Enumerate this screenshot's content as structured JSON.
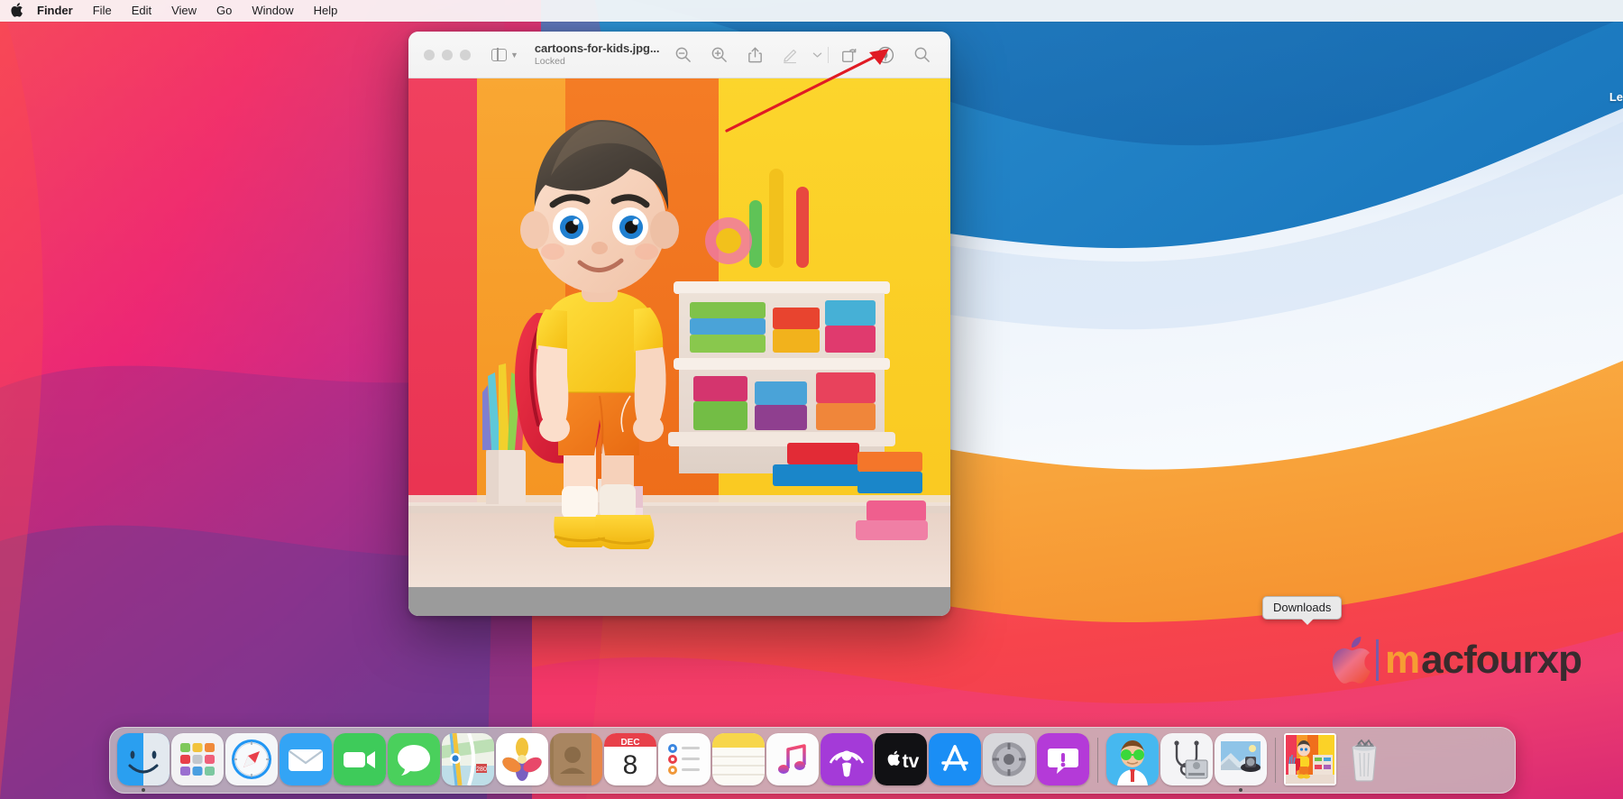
{
  "menubar": {
    "apple_icon": "apple-logo",
    "items": [
      {
        "label": "Finder",
        "bold": true
      },
      {
        "label": "File",
        "bold": false
      },
      {
        "label": "Edit",
        "bold": false
      },
      {
        "label": "View",
        "bold": false
      },
      {
        "label": "Go",
        "bold": false
      },
      {
        "label": "Window",
        "bold": false
      },
      {
        "label": "Help",
        "bold": false
      }
    ]
  },
  "preview_window": {
    "app": "Preview",
    "title": "cartoons-for-kids.jpg...",
    "subtitle": "Locked",
    "traffic_lights": [
      "close",
      "minimize",
      "zoom"
    ],
    "sidebar_toggle": "sidebar-icon",
    "toolbar": [
      {
        "name": "zoom-out-button",
        "icon": "magnifier-minus-icon"
      },
      {
        "name": "zoom-in-button",
        "icon": "magnifier-plus-icon"
      },
      {
        "name": "share-button",
        "icon": "share-icon"
      },
      {
        "name": "markup-pen-button",
        "icon": "pen-icon"
      },
      {
        "name": "markup-dropdown-button",
        "icon": "chevron-down-icon"
      },
      {
        "name": "rotate-button",
        "icon": "rotate-icon"
      },
      {
        "name": "markup-toolbar-button",
        "icon": "markup-circle-pen-icon"
      },
      {
        "name": "search-button",
        "icon": "search-icon"
      }
    ]
  },
  "annotation": {
    "type": "arrow",
    "color": "#e01b24",
    "points_to": "markup-toolbar-button"
  },
  "desktop": {
    "right_edge_text": "Le",
    "wallpaper": "macOS Big Sur waves",
    "colors": {
      "pink": "#f2357a",
      "red": "#f9464b",
      "orange": "#f6a23b",
      "blue": "#1f7ec2",
      "purple": "#6b3f8e"
    }
  },
  "watermark": {
    "apple_icon": "apple-logo",
    "text_m": "m",
    "text_rest": "acfourxp"
  },
  "tooltip": {
    "label": "Downloads"
  },
  "dock": {
    "items": [
      {
        "name": "finder",
        "label": "Finder",
        "running": true
      },
      {
        "name": "launchpad",
        "label": "Launchpad",
        "running": false
      },
      {
        "name": "safari",
        "label": "Safari",
        "running": false
      },
      {
        "name": "mail",
        "label": "Mail",
        "running": false
      },
      {
        "name": "facetime",
        "label": "FaceTime",
        "running": false
      },
      {
        "name": "messages",
        "label": "Messages",
        "running": false
      },
      {
        "name": "maps",
        "label": "Maps",
        "running": false
      },
      {
        "name": "photos",
        "label": "Photos",
        "running": false
      },
      {
        "name": "contacts",
        "label": "Contacts",
        "running": false
      },
      {
        "name": "calendar",
        "label": "Calendar",
        "running": false,
        "month": "DEC",
        "day": "8"
      },
      {
        "name": "reminders",
        "label": "Reminders",
        "running": false
      },
      {
        "name": "notes",
        "label": "Notes",
        "running": false
      },
      {
        "name": "music",
        "label": "Music",
        "running": false
      },
      {
        "name": "podcasts",
        "label": "Podcasts",
        "running": false
      },
      {
        "name": "appletv",
        "label": "Apple TV",
        "running": false
      },
      {
        "name": "appstore",
        "label": "App Store",
        "running": false
      },
      {
        "name": "system-preferences",
        "label": "System Preferences",
        "running": false
      },
      {
        "name": "alert-app",
        "label": "Alert",
        "running": false
      }
    ],
    "stack_items": [
      {
        "name": "mac-doctor",
        "label": "Mac Doctor"
      },
      {
        "name": "disk-utility",
        "label": "Disk Utility"
      },
      {
        "name": "preview",
        "label": "Preview",
        "running": true
      },
      {
        "name": "downloads-stack",
        "label": "Downloads"
      },
      {
        "name": "trash",
        "label": "Trash"
      }
    ]
  },
  "document_image": {
    "description": "3D cartoon boy with backpack in a toy room",
    "panel_colors": [
      "#ee3a5b",
      "#f6912b",
      "#f2701f",
      "#fbd422"
    ],
    "subject": {
      "shirt": "#fbd424",
      "shorts": "#f07a1e",
      "backpack": "#e02233",
      "shoes": "#f7c522",
      "hair": "#4e463f",
      "skin": "#f5ccb8"
    }
  }
}
